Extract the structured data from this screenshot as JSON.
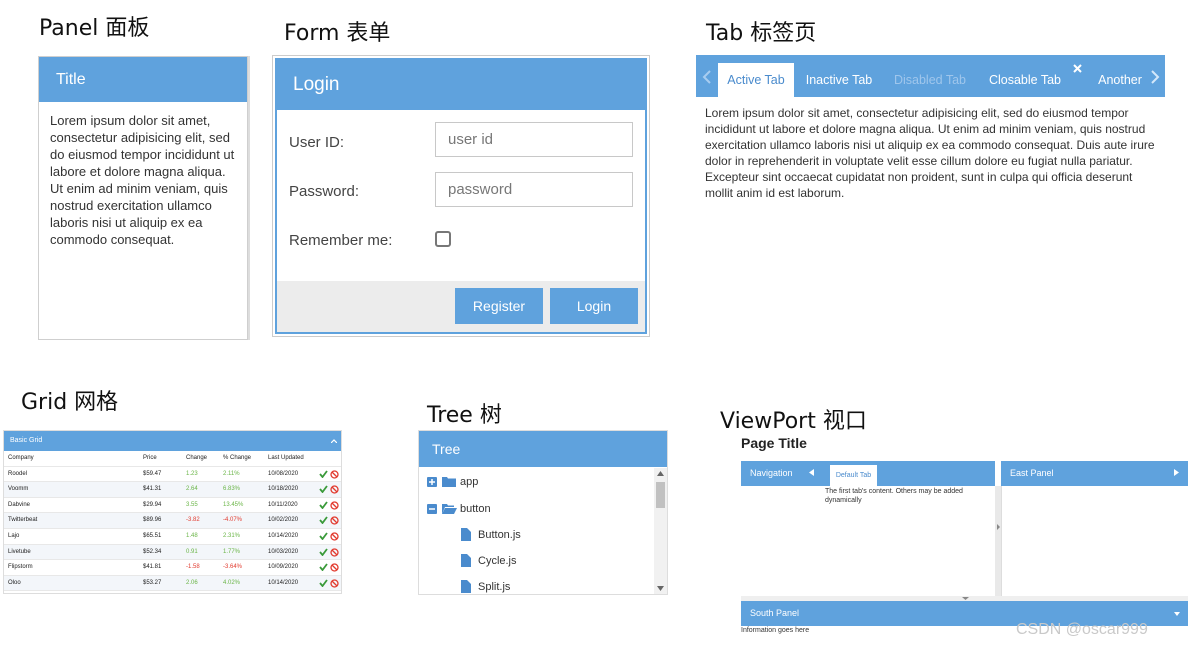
{
  "captions": {
    "panel": "Panel 面板",
    "form": "Form 表单",
    "tab": "Tab 标签页",
    "grid": "Grid  网格",
    "tree": "Tree 树",
    "viewport": "ViewPort 视口"
  },
  "colors": {
    "accent": "#5fa2dd",
    "positive": "#6ab547",
    "negative": "#e23a2e"
  },
  "panel": {
    "title": "Title",
    "body": "Lorem ipsum dolor sit amet, consectetur adipisicing elit, sed do eiusmod tempor incididunt ut labore et dolore magna aliqua. Ut enim ad minim veniam, quis nostrud exercitation ullamco laboris nisi ut aliquip ex ea commodo consequat."
  },
  "form": {
    "title": "Login",
    "userid_label": "User ID:",
    "userid_placeholder": "user id",
    "password_label": "Password:",
    "password_placeholder": "password",
    "remember_label": "Remember me:",
    "register_button": "Register",
    "login_button": "Login"
  },
  "tabs": {
    "items": [
      "Active Tab",
      "Inactive Tab",
      "Disabled Tab",
      "Closable Tab",
      "Another"
    ],
    "body": "Lorem ipsum dolor sit amet, consectetur adipisicing elit, sed do eiusmod tempor incididunt ut labore et dolore magna aliqua. Ut enim ad minim veniam, quis nostrud exercitation ullamco laboris nisi ut aliquip ex ea commodo consequat. Duis aute irure dolor in reprehenderit in voluptate velit esse cillum dolore eu fugiat nulla pariatur. Excepteur sint occaecat cupidatat non proident, sunt in culpa qui officia deserunt mollit anim id est laborum."
  },
  "grid": {
    "title": "Basic Grid",
    "columns": [
      "Company",
      "Price",
      "Change",
      "% Change",
      "Last Updated"
    ],
    "rows": [
      [
        "Roodel",
        "$59.47",
        "1.23",
        "2.11%",
        "10/08/2020"
      ],
      [
        "Voomm",
        "$41.31",
        "2.64",
        "6.83%",
        "10/18/2020"
      ],
      [
        "Dabvine",
        "$29.94",
        "3.55",
        "13.45%",
        "10/11/2020"
      ],
      [
        "Twitterbeat",
        "$89.96",
        "-3.82",
        "-4.07%",
        "10/02/2020"
      ],
      [
        "Lajo",
        "$65.51",
        "1.48",
        "2.31%",
        "10/14/2020"
      ],
      [
        "Livetube",
        "$52.34",
        "0.91",
        "1.77%",
        "10/03/2020"
      ],
      [
        "Flipstorm",
        "$41.81",
        "-1.58",
        "-3.64%",
        "10/09/2020"
      ],
      [
        "Oloo",
        "$53.27",
        "2.06",
        "4.02%",
        "10/14/2020"
      ]
    ]
  },
  "tree": {
    "title": "Tree",
    "nodes": [
      "app",
      "button",
      "Button.js",
      "Cycle.js",
      "Split.js"
    ]
  },
  "viewport": {
    "page_title": "Page Title",
    "navigation": "Navigation",
    "default_tab": "Default Tab",
    "tab_content": "The first tab's content. Others may be added dynamically",
    "east_panel": "East Panel",
    "south_panel": "South Panel",
    "south_content": "Information goes here"
  },
  "watermark": "CSDN @oscar999"
}
